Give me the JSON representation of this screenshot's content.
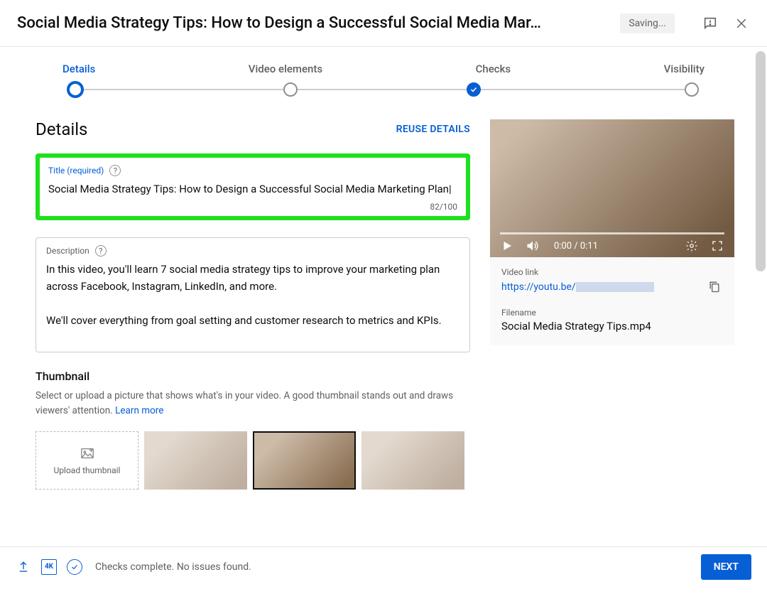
{
  "header": {
    "title": "Social Media Strategy Tips: How to Design a Successful Social Media Mar…",
    "saving": "Saving..."
  },
  "stepper": {
    "steps": [
      {
        "label": "Details",
        "state": "current"
      },
      {
        "label": "Video elements",
        "state": "pending"
      },
      {
        "label": "Checks",
        "state": "done"
      },
      {
        "label": "Visibility",
        "state": "pending"
      }
    ]
  },
  "details": {
    "section_title": "Details",
    "reuse": "REUSE DETAILS",
    "title_field": {
      "label": "Title (required)",
      "value": "Social Media Strategy Tips: How to Design a Successful Social Media Marketing Plan",
      "count": "82/100"
    },
    "description_field": {
      "label": "Description",
      "value": "In this video, you'll learn 7 social media strategy tips to improve your marketing plan across Facebook, Instagram, LinkedIn, and more.\n\nWe'll cover everything from goal setting and customer research to metrics and KPIs."
    },
    "thumbnail": {
      "title": "Thumbnail",
      "desc": "Select or upload a picture that shows what's in your video. A good thumbnail stands out and draws viewers' attention. ",
      "learn_more": "Learn more",
      "upload_label": "Upload thumbnail"
    }
  },
  "player": {
    "time": "0:00 / 0:11"
  },
  "video_info": {
    "link_label": "Video link",
    "link": "https://youtu.be/",
    "filename_label": "Filename",
    "filename": "Social Media Strategy Tips.mp4"
  },
  "footer": {
    "hd_label": "4K",
    "status": "Checks complete. No issues found.",
    "next": "NEXT"
  }
}
